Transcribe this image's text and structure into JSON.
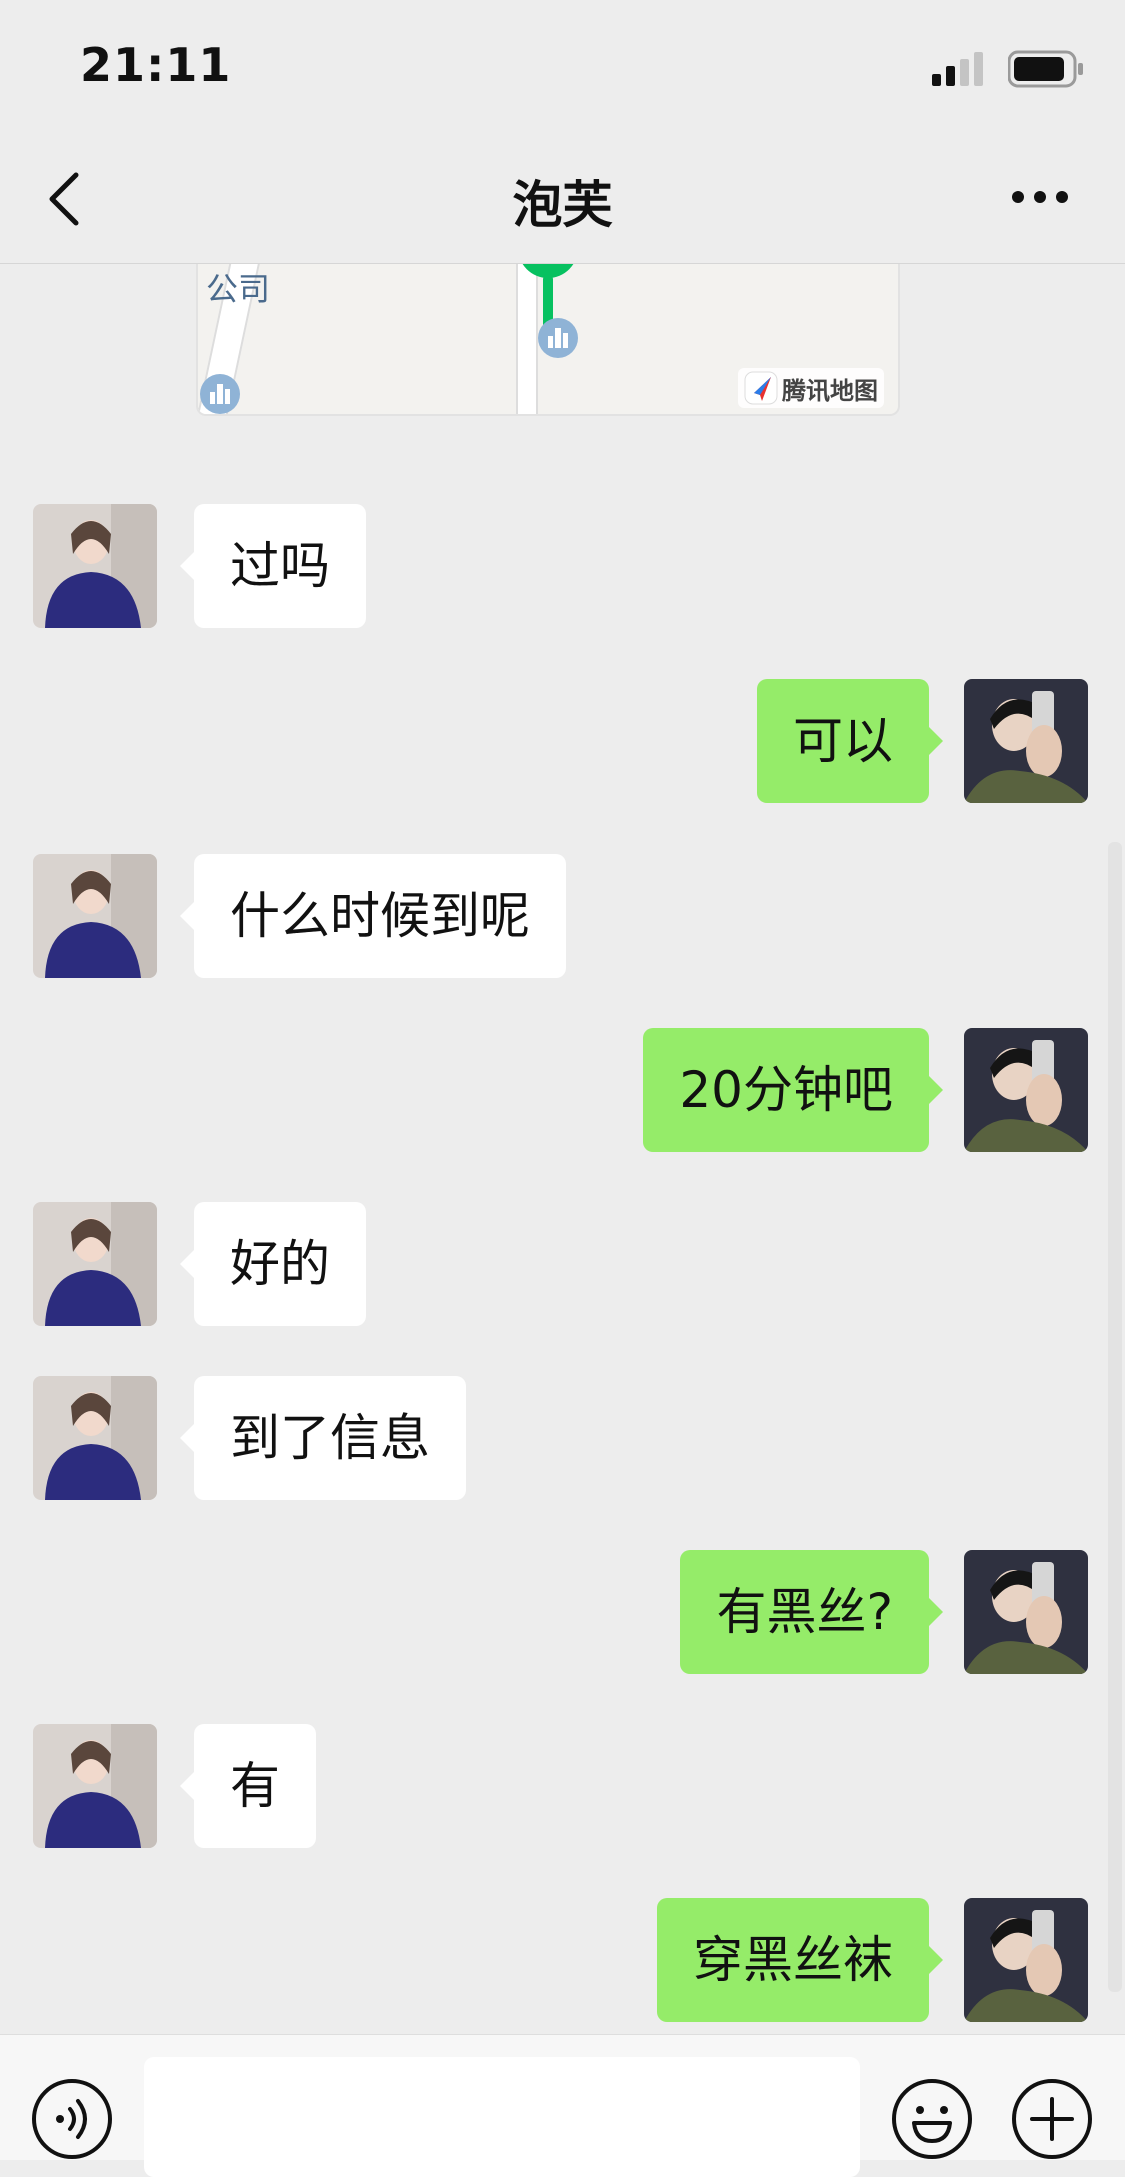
{
  "status_bar": {
    "time": "21:11"
  },
  "header": {
    "title": "泡芙",
    "back_icon": "chevron-left-icon",
    "more_icon": "ellipsis-icon"
  },
  "map_card": {
    "place_label": "公司",
    "provider": "腾讯地图"
  },
  "messages": [
    {
      "side": "left",
      "text": "过吗"
    },
    {
      "side": "right",
      "text": "可以"
    },
    {
      "side": "left",
      "text": "什么时候到呢"
    },
    {
      "side": "right",
      "text": "20分钟吧"
    },
    {
      "side": "left",
      "text": "好的"
    },
    {
      "side": "left",
      "text": "到了信息"
    },
    {
      "side": "right",
      "text": "有黑丝?"
    },
    {
      "side": "left",
      "text": "有"
    },
    {
      "side": "right",
      "text": "穿黑丝袜"
    }
  ],
  "input_bar": {
    "text_value": "",
    "voice_icon": "voice-icon",
    "emoji_icon": "emoji-icon",
    "plus_icon": "plus-icon"
  },
  "colors": {
    "background": "#ededed",
    "bubble_self": "#95ec69",
    "bubble_other": "#ffffff",
    "map_pin": "#07c160"
  }
}
